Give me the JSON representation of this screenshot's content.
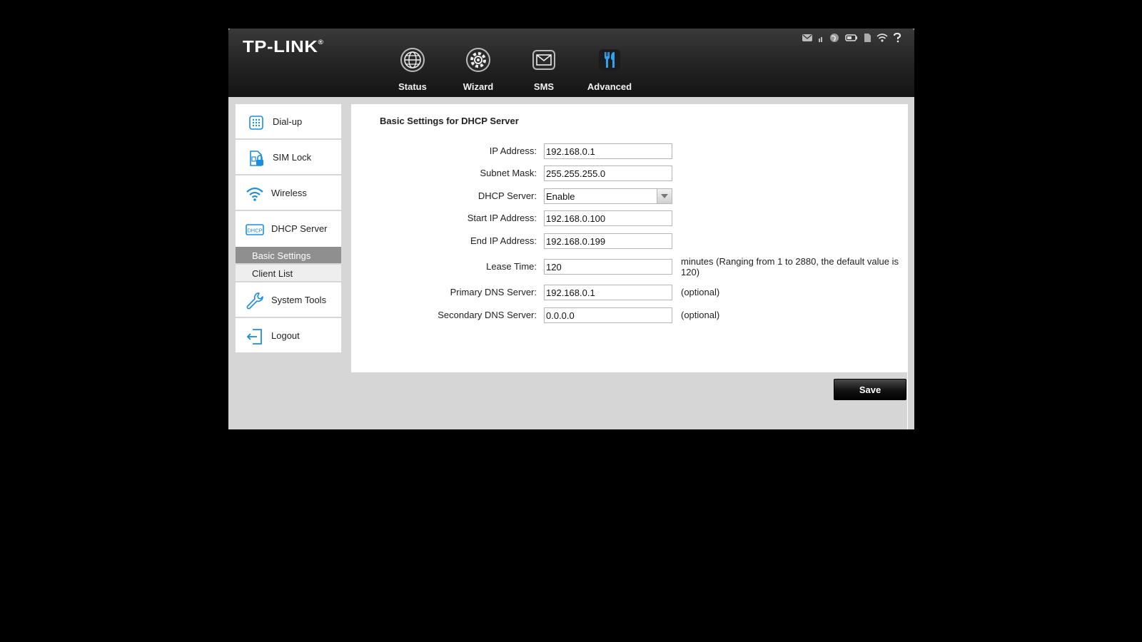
{
  "header": {
    "logo": "TP-LINK",
    "logo_mark": "®",
    "nav": [
      {
        "label": "Status",
        "icon": "globe-icon"
      },
      {
        "label": "Wizard",
        "icon": "gear-icon"
      },
      {
        "label": "SMS",
        "icon": "envelope-icon"
      },
      {
        "label": "Advanced",
        "icon": "tools-icon",
        "active": true
      }
    ],
    "status_icons": [
      "mail-icon",
      "signal-icon",
      "internet-icon",
      "battery-icon",
      "sd-card-icon",
      "wifi-icon",
      "help-icon"
    ]
  },
  "sidebar": {
    "items": [
      {
        "label": "Dial-up",
        "icon": "dialpad-icon"
      },
      {
        "label": "SIM Lock",
        "icon": "sim-lock-icon"
      },
      {
        "label": "Wireless",
        "icon": "wifi-icon"
      },
      {
        "label": "DHCP Server",
        "icon": "dhcp-icon"
      },
      {
        "label": "System Tools",
        "icon": "wrench-icon"
      },
      {
        "label": "Logout",
        "icon": "logout-icon"
      }
    ],
    "sub_items": [
      {
        "label": "Basic Settings",
        "active": true
      },
      {
        "label": "Client List",
        "active": false
      }
    ]
  },
  "form": {
    "title": "Basic Settings for DHCP Server",
    "ip_address": {
      "label": "IP Address:",
      "value": "192.168.0.1"
    },
    "subnet_mask": {
      "label": "Subnet Mask:",
      "value": "255.255.255.0"
    },
    "dhcp_server": {
      "label": "DHCP Server:",
      "value": "Enable"
    },
    "start_ip": {
      "label": "Start IP Address:",
      "value": "192.168.0.100"
    },
    "end_ip": {
      "label": "End IP Address:",
      "value": "192.168.0.199"
    },
    "lease_time": {
      "label": "Lease Time:",
      "value": "120",
      "note": "minutes (Ranging from 1 to 2880, the default value is 120)"
    },
    "primary_dns": {
      "label": "Primary DNS Server:",
      "value": "192.168.0.1",
      "note": "(optional)"
    },
    "secondary_dns": {
      "label": "Secondary DNS Server:",
      "value": "0.0.0.0",
      "note": "(optional)"
    }
  },
  "actions": {
    "save_label": "Save"
  },
  "colors": {
    "accent_blue": "#1a8ee0",
    "header_dark": "#1e1e1e",
    "active_sub": "#8f8f8f"
  }
}
